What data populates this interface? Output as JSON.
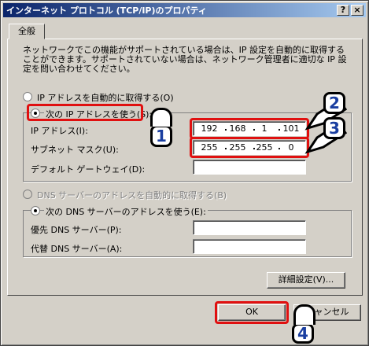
{
  "window": {
    "title": "インターネット プロトコル (TCP/IP)のプロパティ",
    "help_label": "?",
    "close_label": "×"
  },
  "tab": {
    "label": "全般"
  },
  "description": "ネットワークでこの機能がサポートされている場合は、IP 設定を自動的に取得することができます。サポートされていない場合は、ネットワーク管理者に適切な IP 設定を問い合わせてください。",
  "ip": {
    "auto_label": "IP アドレスを自動的に取得する(O)",
    "manual_label": "次の IP アドレスを使う(S):",
    "address_label": "IP アドレス(I):",
    "address": [
      "192",
      "168",
      "1",
      "101"
    ],
    "subnet_label": "サブネット マスク(U):",
    "subnet": [
      "255",
      "255",
      "255",
      "0"
    ],
    "gateway_label": "デフォルト ゲートウェイ(D):"
  },
  "dns": {
    "auto_label": "DNS サーバーのアドレスを自動的に取得する(B)",
    "manual_label": "次の DNS サーバーのアドレスを使う(E):",
    "preferred_label": "優先 DNS サーバー(P):",
    "alternate_label": "代替 DNS サーバー(A):"
  },
  "buttons": {
    "advanced": "詳細設定(V)...",
    "ok": "OK",
    "cancel": "キャンセル"
  },
  "badges": [
    "1",
    "2",
    "3",
    "4"
  ],
  "colors": {
    "titlebar_start": "#0a246a",
    "highlight": "#e01010",
    "badge_number": "#1a3ea0"
  }
}
